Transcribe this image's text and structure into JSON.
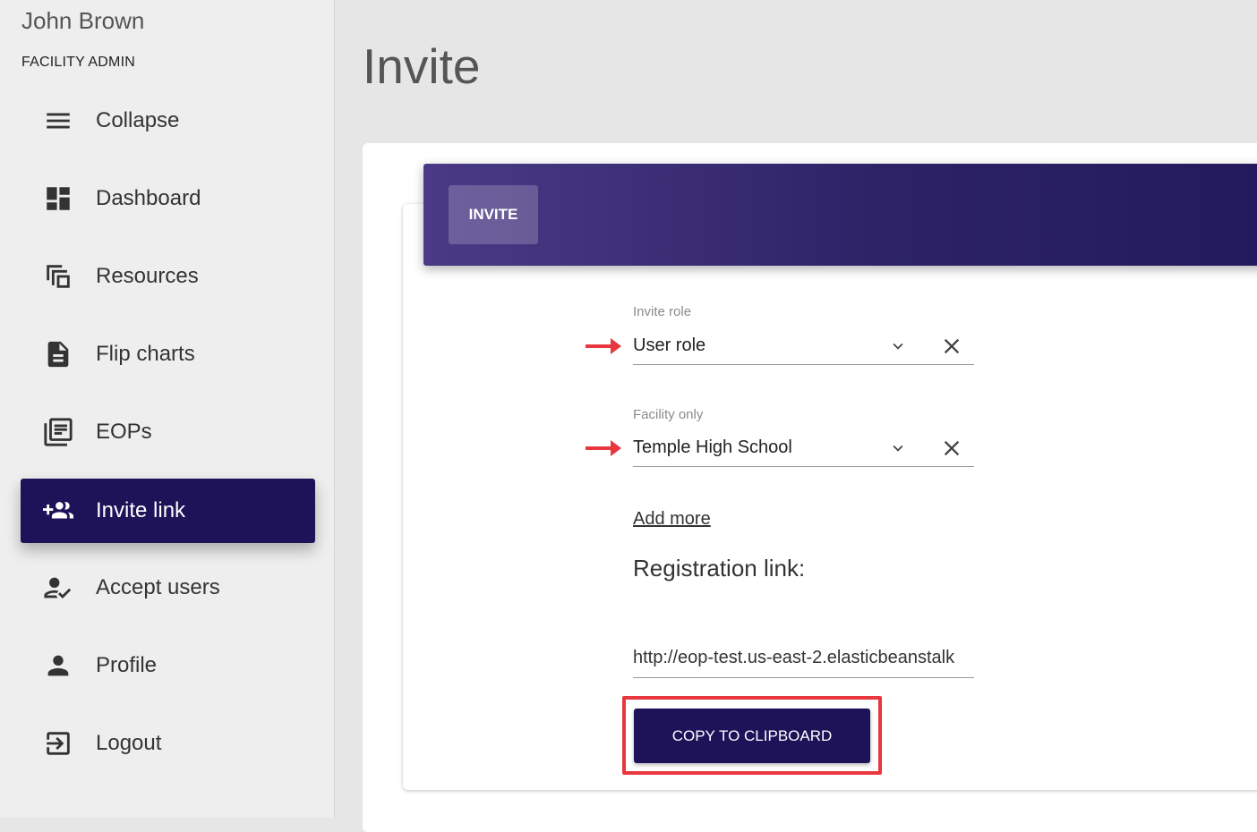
{
  "sidebar": {
    "user_name": "John Brown",
    "user_role": "FACILITY ADMIN",
    "items": [
      {
        "label": "Collapse",
        "icon": "menu-icon"
      },
      {
        "label": "Dashboard",
        "icon": "dashboard-icon"
      },
      {
        "label": "Resources",
        "icon": "copy-icon"
      },
      {
        "label": "Flip charts",
        "icon": "file-icon"
      },
      {
        "label": "EOPs",
        "icon": "documents-icon"
      },
      {
        "label": "Invite link",
        "icon": "group-add-icon",
        "active": true
      },
      {
        "label": "Accept users",
        "icon": "user-check-icon"
      },
      {
        "label": "Profile",
        "icon": "person-icon"
      },
      {
        "label": "Logout",
        "icon": "logout-icon"
      }
    ]
  },
  "main": {
    "page_title": "Invite",
    "tab_label": "INVITE",
    "invite_role": {
      "label": "Invite role",
      "value": "User role"
    },
    "facility": {
      "label": "Facility only",
      "value": "Temple High School"
    },
    "add_more": "Add more",
    "registration_label": "Registration link:",
    "registration_link": "http://eop-test.us-east-2.elasticbeanstalk",
    "copy_button": "COPY TO CLIPBOARD"
  },
  "colors": {
    "accent": "#1e1259",
    "annotation_red": "#e8373f"
  }
}
